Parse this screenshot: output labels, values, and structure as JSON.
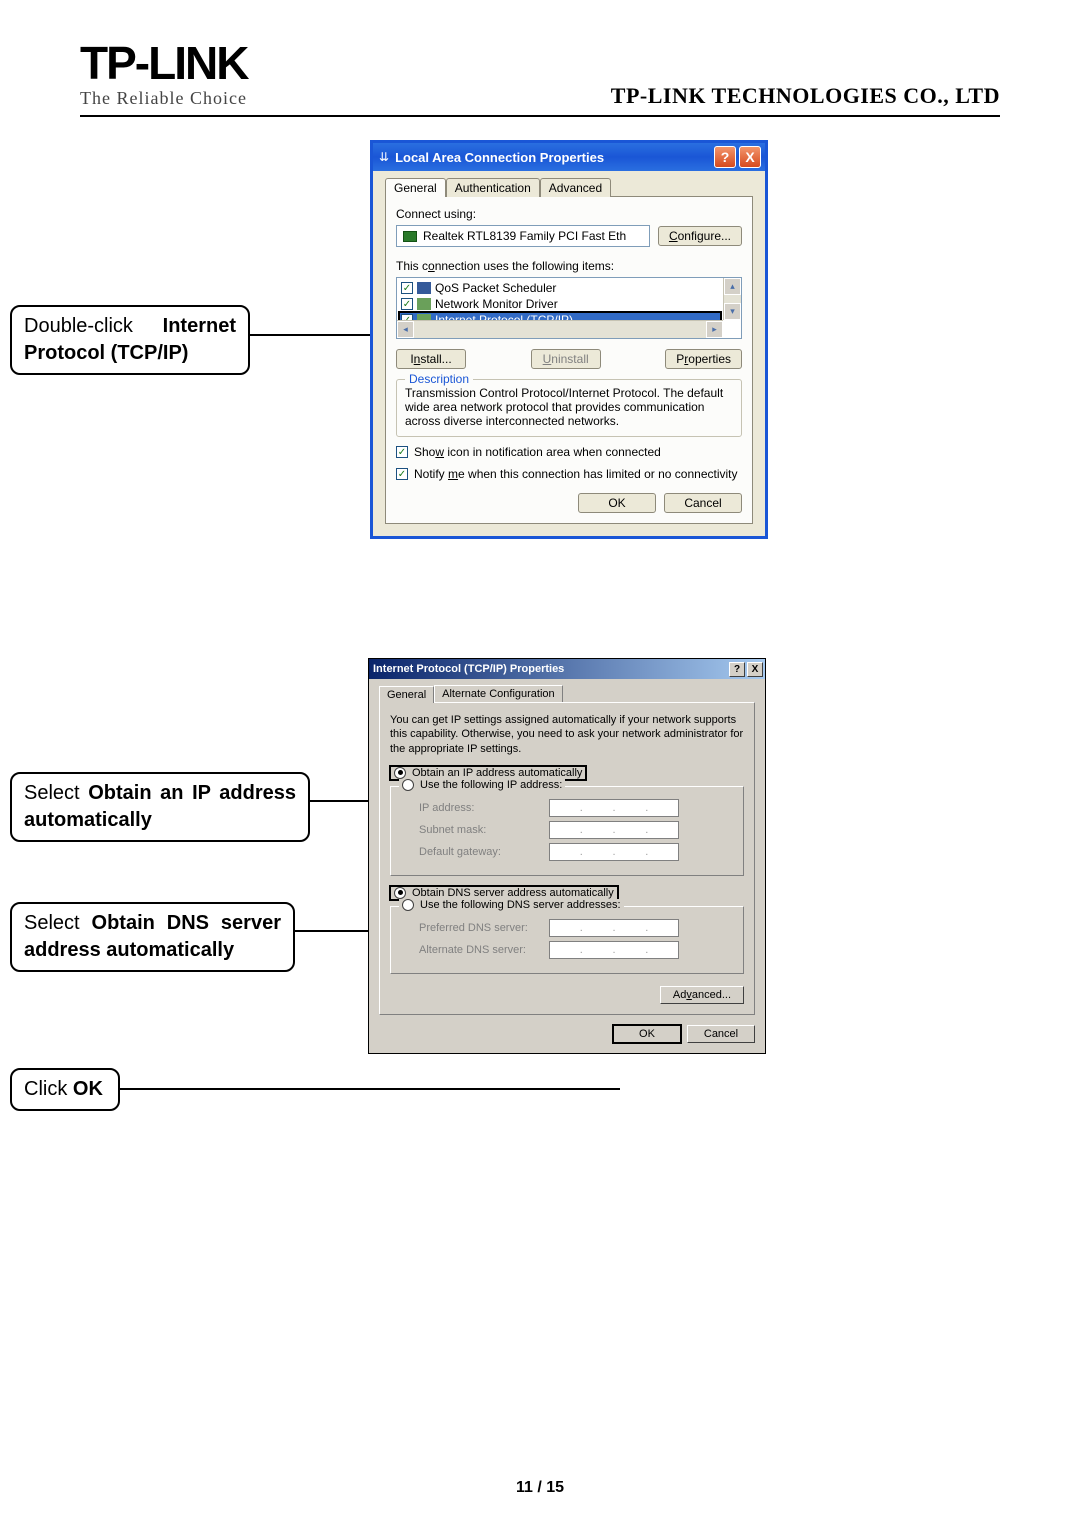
{
  "header": {
    "logo": "TP-LINK",
    "tagline": "The Reliable Choice",
    "company": "TP-LINK TECHNOLOGIES CO., LTD"
  },
  "callouts": {
    "c1_pre": "Double-click ",
    "c1_bold": "Internet Protocol (TCP/IP)",
    "c2_pre": "Select ",
    "c2_bold": "Obtain an IP address automatically",
    "c3_pre": "Select ",
    "c3_bold": "Obtain DNS server address automatically",
    "c4_pre": "Click ",
    "c4_bold": "OK"
  },
  "dialog1": {
    "title": "Local Area Connection Properties",
    "help": "?",
    "close": "X",
    "tabs": {
      "general": "General",
      "auth": "Authentication",
      "advanced": "Advanced"
    },
    "connect_using": "Connect using:",
    "nic": "Realtek RTL8139 Family PCI Fast Eth",
    "configure": "Configure...",
    "items_label": "This connection uses the following items:",
    "items": {
      "qos": "QoS Packet Scheduler",
      "nmd": "Network Monitor Driver",
      "tcpip": "Internet Protocol (TCP/IP)"
    },
    "install": "Install...",
    "uninstall": "Uninstall",
    "properties": "Properties",
    "desc_legend": "Description",
    "desc_text": "Transmission Control Protocol/Internet Protocol. The default wide area network protocol that provides communication across diverse interconnected networks.",
    "show_icon": "Show icon in notification area when connected",
    "notify": "Notify me when this connection has limited or no connectivity",
    "ok": "OK",
    "cancel": "Cancel"
  },
  "dialog2": {
    "title": "Internet Protocol (TCP/IP) Properties",
    "help": "?",
    "close": "X",
    "tabs": {
      "general": "General",
      "alt": "Alternate Configuration"
    },
    "intro": "You can get IP settings assigned automatically if your network supports this capability. Otherwise, you need to ask your network administrator for the appropriate IP settings.",
    "r_ip_auto": "Obtain an IP address automatically",
    "r_ip_manual": "Use the following IP address:",
    "ip_address": "IP address:",
    "subnet": "Subnet mask:",
    "gateway": "Default gateway:",
    "r_dns_auto": "Obtain DNS server address automatically",
    "r_dns_manual": "Use the following DNS server addresses:",
    "pref_dns": "Preferred DNS server:",
    "alt_dns": "Alternate DNS server:",
    "advanced": "Advanced...",
    "ok": "OK",
    "cancel": "Cancel"
  },
  "footer": {
    "page": "11 / 15"
  }
}
